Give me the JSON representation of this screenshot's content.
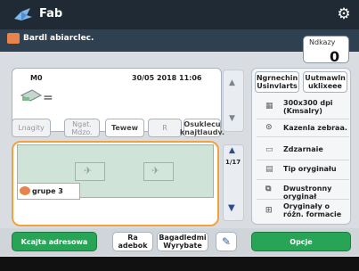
{
  "app": {
    "title": "Fab"
  },
  "notice": {
    "text": "Bardl abiarclec."
  },
  "copies": {
    "label": "Ndkazy",
    "value": "0"
  },
  "document": {
    "line1": "M0",
    "datetime": "30/05 2018 11:06"
  },
  "options_row": {
    "b1": "Lnagity",
    "b2": "Ngat. Mdzo.",
    "b3": "Tewew",
    "b4": "R",
    "b5": "Osuklecu knajtlaudv."
  },
  "scheduler": {
    "group_label": "grupe 3",
    "page_indicator": "1/17"
  },
  "side_panel": {
    "top_left": "Ngrnechin Usinvlarts",
    "top_right": "Uutmawln uklixeee",
    "items": [
      {
        "label": "300x300 dpi (Kmsalry)"
      },
      {
        "label": "Kazenla zebraa."
      },
      {
        "label": "Zdzarnaie"
      },
      {
        "label": "Tip oryginału"
      },
      {
        "label": "Dwustronny oryginał"
      },
      {
        "label": "Oryginały o różn. formacie"
      }
    ]
  },
  "bottom": {
    "left": "Kcajta adresowa",
    "mid1": "Ra adebok",
    "mid2": "Bagadledmi Wyrybate",
    "right": "Opcje"
  },
  "colors": {
    "accent": "#28a457",
    "highlight": "#f1a23e"
  }
}
